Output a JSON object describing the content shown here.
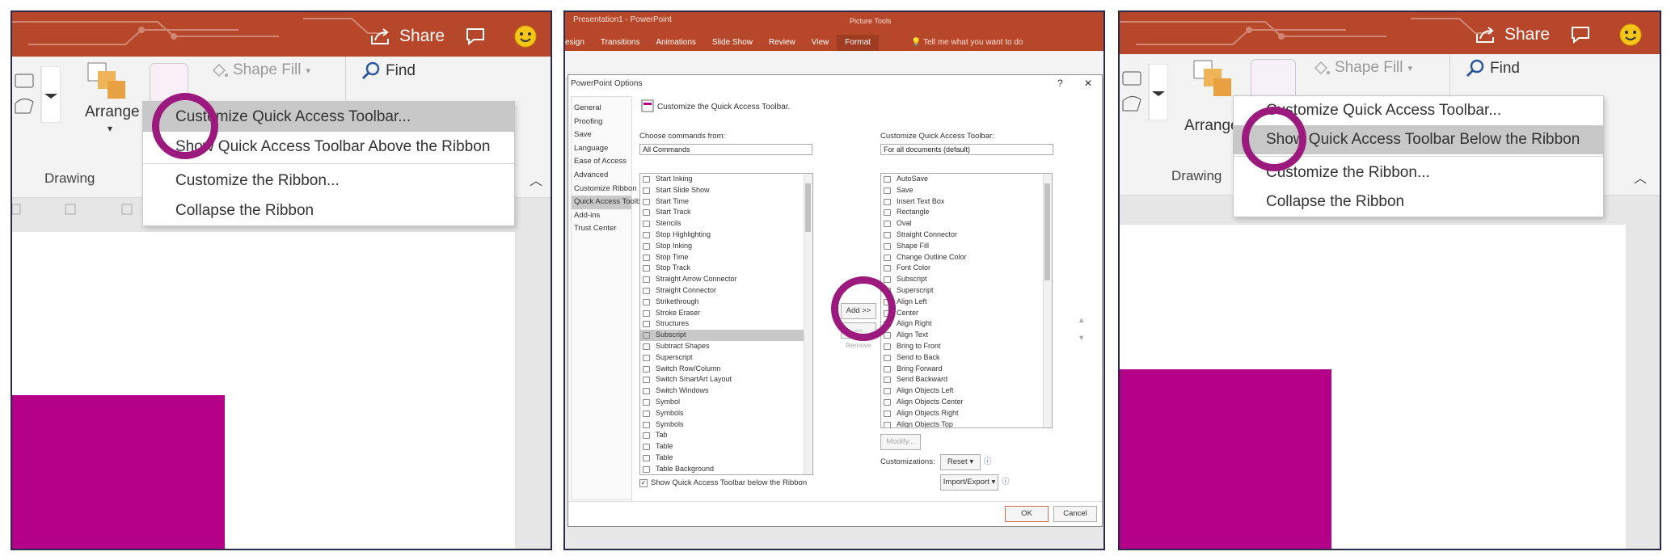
{
  "panel1": {
    "share": "Share",
    "arrange": "Arrange",
    "shape_fill": "Shape Fill",
    "find": "Find",
    "drawing": "Drawing",
    "menu": [
      "Customize Quick Access Toolbar...",
      "Show Quick Access Toolbar Above the Ribbon",
      "Customize the Ribbon...",
      "Collapse the Ribbon"
    ]
  },
  "panel2": {
    "window_title": "Presentation1 - PowerPoint",
    "picture_tools": "Picture Tools",
    "tabs": [
      "esign",
      "Transitions",
      "Animations",
      "Slide Show",
      "Review",
      "View",
      "Format"
    ],
    "tell_me": "Tell me what you want to do",
    "dialog_title": "PowerPoint Options",
    "help": "?",
    "close": "✕",
    "nav": [
      "General",
      "Proofing",
      "Save",
      "Language",
      "Ease of Access",
      "Advanced",
      "Customize Ribbon",
      "Quick Access Toolbar",
      "Add-ins",
      "Trust Center"
    ],
    "heading": "Customize the Quick Access Toolbar.",
    "choose_label": "Choose commands from:",
    "choose_value": "All Commands",
    "customize_label": "Customize Quick Access Toolbar:",
    "customize_value": "For all documents (default)",
    "commands": [
      "Start Inking",
      "Start Slide Show",
      "Start Time",
      "Start Track",
      "Stencils",
      "Stop Highlighting",
      "Stop Inking",
      "Stop Time",
      "Stop Track",
      "Straight Arrow Connector",
      "Straight Connector",
      "Strikethrough",
      "Stroke Eraser",
      "Structures",
      "Subscript",
      "Subtract Shapes",
      "Superscript",
      "Switch Row/Column",
      "Switch SmartArt Layout",
      "Switch Windows",
      "Symbol",
      "Symbols",
      "Symbols",
      "Tab",
      "Table",
      "Table",
      "Table Background"
    ],
    "toolbar_items": [
      "AutoSave",
      "Save",
      "Insert Text Box",
      "Rectangle",
      "Oval",
      "Straight Connector",
      "Shape Fill",
      "Change Outline Color",
      "Font Color",
      "Subscript",
      "Superscript",
      "Align Left",
      "Center",
      "Align Right",
      "Align Text",
      "Bring to Front",
      "Send to Back",
      "Bring Forward",
      "Send Backward",
      "Align Objects Left",
      "Align Objects Center",
      "Align Objects Right",
      "Align Objects Top"
    ],
    "add": "Add >>",
    "remove": "<< Remove",
    "modify": "Modify...",
    "customizations": "Customizations:",
    "reset": "Reset ▾",
    "import_export": "Import/Export ▾",
    "show_below": "Show Quick Access Toolbar below the Ribbon",
    "ok": "OK",
    "cancel": "Cancel"
  },
  "panel3": {
    "share": "Share",
    "arrange": "Arrange",
    "shape_fill": "Shape Fill",
    "find": "Find",
    "drawing": "Drawing",
    "menu": [
      "Customize Quick Access Toolbar...",
      "Show Quick Access Toolbar Below the Ribbon",
      "Customize the Ribbon...",
      "Collapse the Ribbon"
    ]
  },
  "colors": {
    "title_bar": "#b7472a",
    "highlight_circle": "#9c1a7e",
    "slide_shape": "#b5008a",
    "menu_highlight": "#c8c8c8"
  }
}
